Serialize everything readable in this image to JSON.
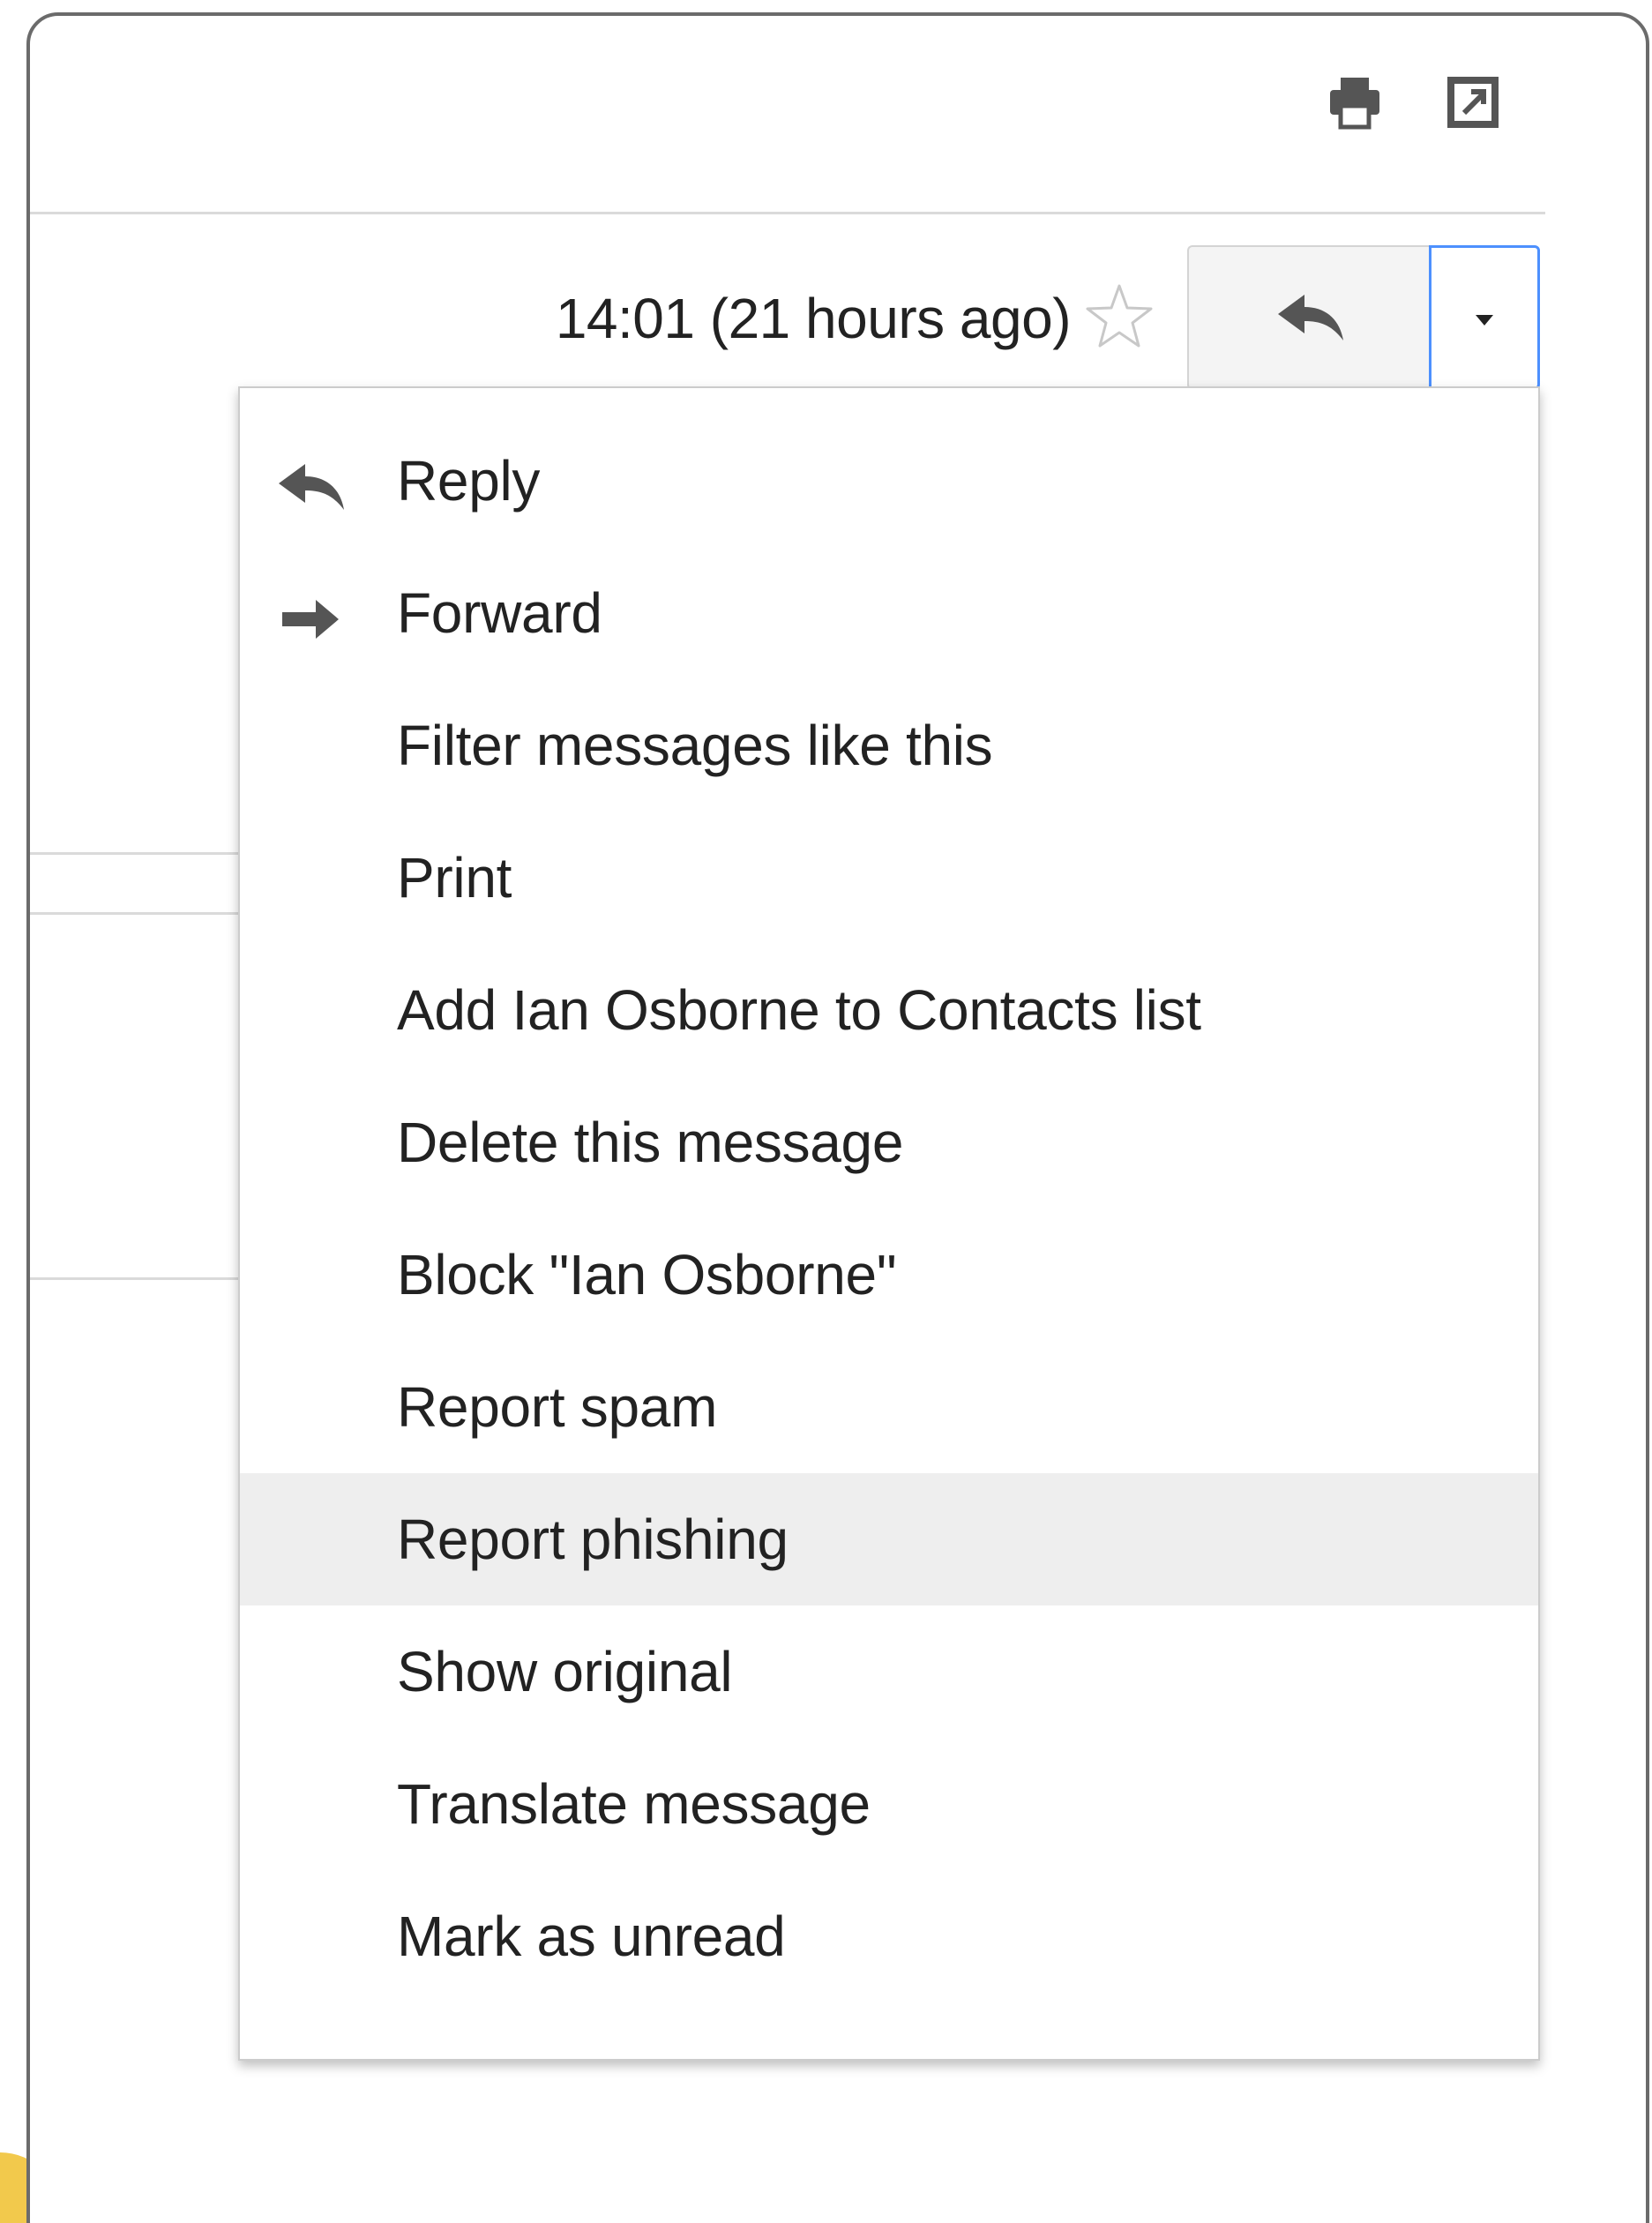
{
  "colors": {
    "accent_border": "#4d90fe",
    "menu_hover": "#eeeeee",
    "text": "#222222",
    "icon": "#555555"
  },
  "toolbar": {
    "icons": [
      "print-icon",
      "popout-icon"
    ]
  },
  "message_header": {
    "timestamp": "14:01 (21 hours ago)",
    "star_icon": "star-outline-icon",
    "reply_icon": "reply-arrow-icon",
    "more_icon": "dropdown-caret-icon"
  },
  "menu": {
    "items": [
      {
        "label": "Reply",
        "icon": "reply-arrow-icon"
      },
      {
        "label": "Forward",
        "icon": "forward-arrow-icon"
      },
      {
        "label": "Filter messages like this"
      },
      {
        "label": "Print"
      },
      {
        "label": "Add Ian Osborne to Contacts list"
      },
      {
        "label": "Delete this message"
      },
      {
        "label": "Block \"Ian Osborne\""
      },
      {
        "label": "Report spam"
      },
      {
        "label": "Report phishing",
        "highlighted": true
      },
      {
        "label": "Show original"
      },
      {
        "label": "Translate message"
      },
      {
        "label": "Mark as unread"
      }
    ]
  }
}
